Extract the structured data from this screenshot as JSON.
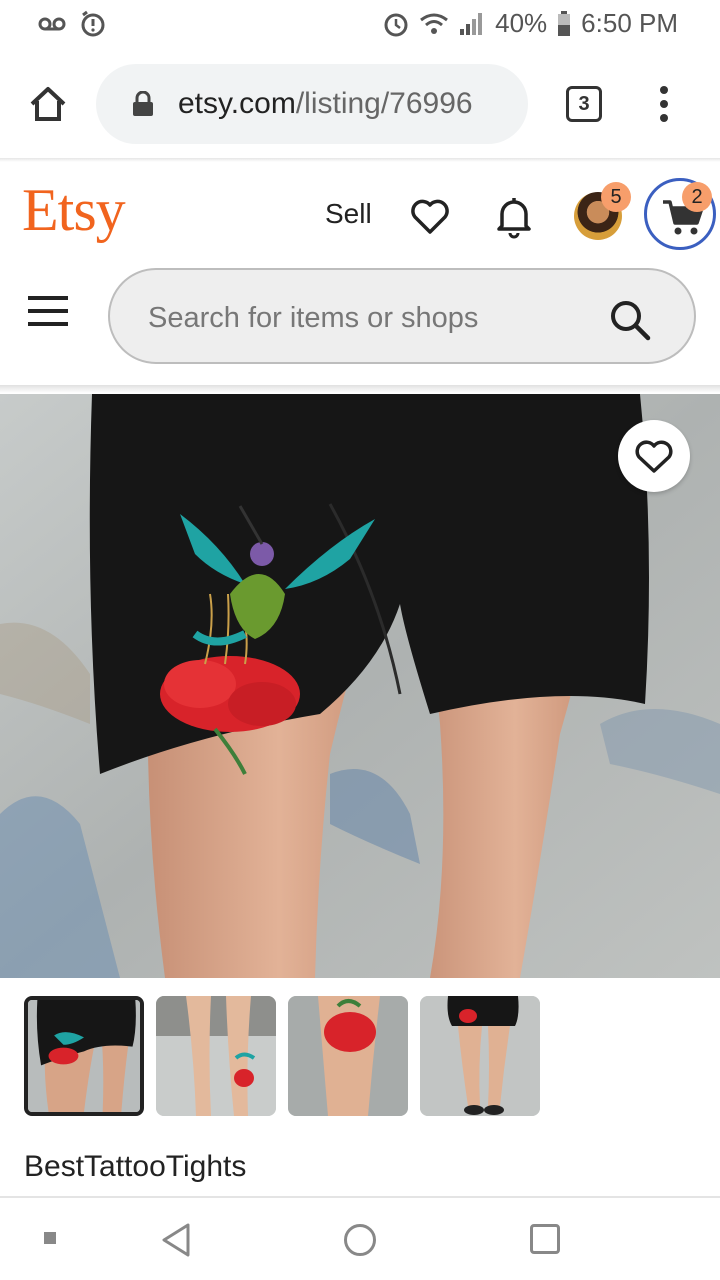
{
  "status_bar": {
    "battery": "40%",
    "time": "6:50 PM",
    "icons": [
      "voicemail-icon",
      "alarm-alert-icon",
      "alarm-icon",
      "wifi-icon",
      "signal-icon",
      "battery-icon"
    ]
  },
  "browser": {
    "url_host": "etsy.com",
    "url_path": "/listing/76996",
    "tab_count": "3"
  },
  "header": {
    "logo": "Etsy",
    "sell_label": "Sell",
    "avatar_badge": "5",
    "cart_badge": "2",
    "search_placeholder": "Search for items or shops"
  },
  "listing": {
    "shop_name": "BestTattooTights",
    "thumbnail_count": 4,
    "selected_thumbnail": 1
  },
  "colors": {
    "brand": "#f1641e",
    "badge": "#f79e6b",
    "cart_ring": "#3b5fc0"
  }
}
